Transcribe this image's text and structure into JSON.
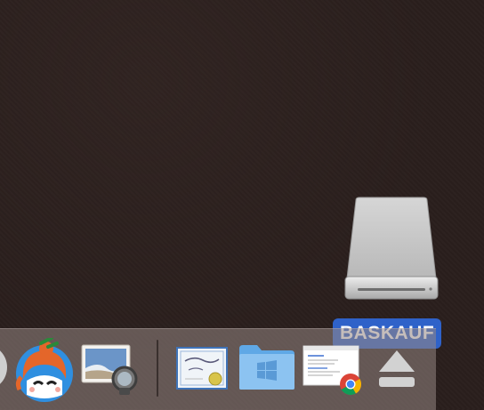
{
  "desktop": {
    "drive": {
      "label": "BASKAUF",
      "icon": "external-drive-icon"
    }
  },
  "dock": {
    "items": [
      {
        "icon": "app-partial-icon"
      },
      {
        "icon": "cartoon-character-app-icon"
      },
      {
        "icon": "preview-app-icon"
      },
      {
        "icon": "certificate-document-icon"
      },
      {
        "icon": "windows-folder-icon"
      },
      {
        "icon": "chrome-webpage-document-icon"
      },
      {
        "icon": "eject-icon"
      }
    ]
  }
}
